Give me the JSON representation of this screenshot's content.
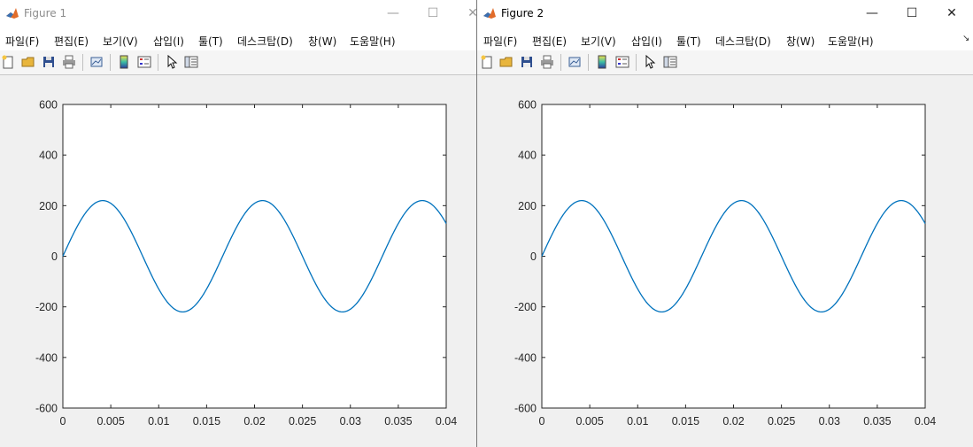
{
  "windows": [
    {
      "title": "Figure 1",
      "menu": [
        "파일(F)",
        "편집(E)",
        "보기(V)",
        "삽입(I)",
        "툴(T)",
        "데스크탑(D)",
        "창(W)",
        "도움말(H)"
      ],
      "controls": {
        "minimize": "—",
        "maximize": "☐",
        "close": "✕"
      },
      "active": false
    },
    {
      "title": "Figure 2",
      "menu": [
        "파일(F)",
        "편집(E)",
        "보기(V)",
        "삽입(I)",
        "툴(T)",
        "데스크탑(D)",
        "창(W)",
        "도움말(H)"
      ],
      "controls": {
        "minimize": "—",
        "maximize": "☐",
        "close": "✕",
        "expand": "↘"
      },
      "active": true
    }
  ],
  "toolbar_icons": [
    "new-figure-icon",
    "open-file-icon",
    "save-icon",
    "print-icon",
    "link-plot-icon",
    "insert-colorbar-icon",
    "insert-legend-icon",
    "edit-plot-icon",
    "property-inspector-icon"
  ],
  "chart_data": [
    {
      "type": "line",
      "title": "",
      "xlabel": "",
      "ylabel": "",
      "xlim": [
        0,
        0.04
      ],
      "ylim": [
        -600,
        600
      ],
      "x_ticks": [
        "0",
        "0.005",
        "0.01",
        "0.015",
        "0.02",
        "0.025",
        "0.03",
        "0.035",
        "0.04"
      ],
      "y_ticks": [
        "600",
        "400",
        "200",
        "0",
        "-200",
        "-400",
        "-600"
      ],
      "grid": false,
      "series": [
        {
          "amplitude": 220,
          "frequency_hz": 60,
          "color": "#0072bd",
          "x": [
            0,
            0.002,
            0.004,
            0.0042,
            0.006,
            0.008,
            0.0083,
            0.01,
            0.0125,
            0.014,
            0.0167,
            0.018,
            0.0208,
            0.022,
            0.025,
            0.027,
            0.0292,
            0.031,
            0.0333,
            0.035,
            0.0375,
            0.04
          ],
          "y": [
            0,
            150,
            219,
            220,
            178,
            50,
            0,
            -130,
            -220,
            -183,
            0,
            130,
            220,
            183,
            0,
            -150,
            -220,
            -153,
            0,
            150,
            220,
            150
          ]
        }
      ]
    },
    {
      "type": "line",
      "title": "",
      "xlabel": "",
      "ylabel": "",
      "xlim": [
        0,
        0.04
      ],
      "ylim": [
        -600,
        600
      ],
      "x_ticks": [
        "0",
        "0.005",
        "0.01",
        "0.015",
        "0.02",
        "0.025",
        "0.03",
        "0.035",
        "0.04"
      ],
      "y_ticks": [
        "600",
        "400",
        "200",
        "0",
        "-200",
        "-400",
        "-600"
      ],
      "grid": false,
      "series": [
        {
          "amplitude": 220,
          "frequency_hz": 60,
          "color": "#0072bd",
          "x": [
            0,
            0.002,
            0.004,
            0.0042,
            0.006,
            0.008,
            0.0083,
            0.01,
            0.0125,
            0.014,
            0.0167,
            0.018,
            0.0208,
            0.022,
            0.025,
            0.027,
            0.0292,
            0.031,
            0.0333,
            0.035,
            0.0375,
            0.04
          ],
          "y": [
            0,
            150,
            219,
            220,
            178,
            50,
            0,
            -130,
            -220,
            -183,
            0,
            130,
            220,
            183,
            0,
            -150,
            -220,
            -153,
            0,
            150,
            220,
            150
          ]
        }
      ]
    }
  ]
}
